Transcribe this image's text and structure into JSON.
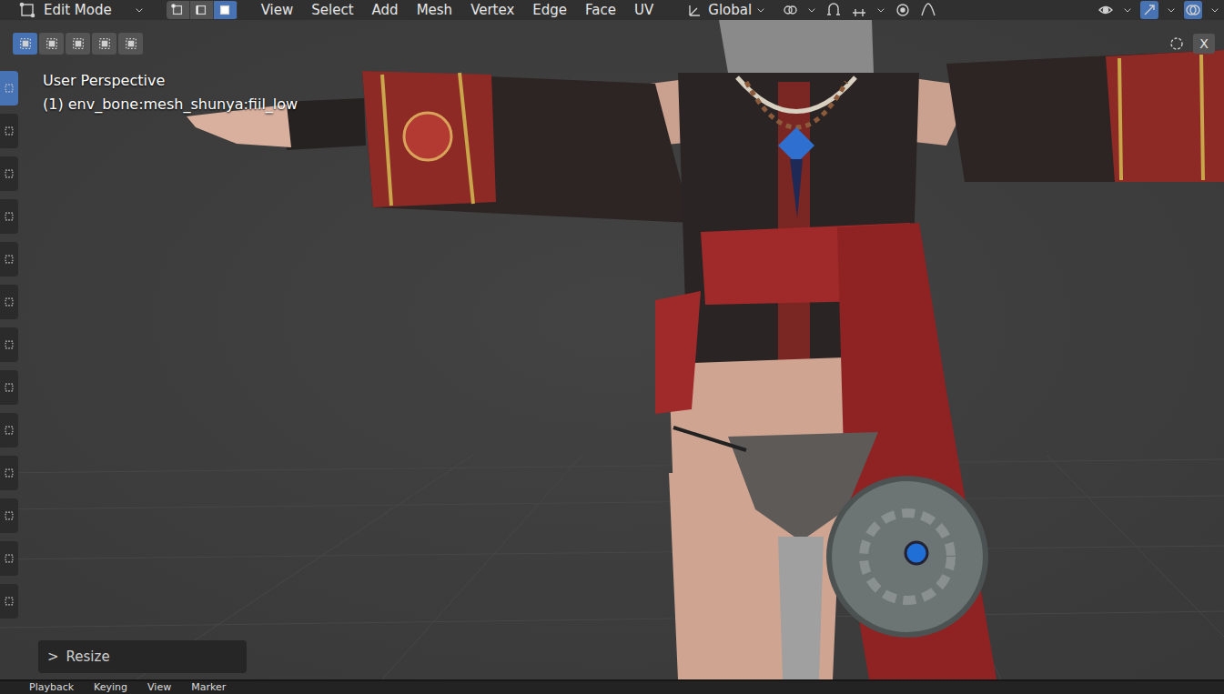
{
  "header": {
    "mode": "Edit Mode",
    "select_modes": [
      {
        "selected": false
      },
      {
        "selected": false
      },
      {
        "selected": true
      }
    ],
    "menus": [
      "View",
      "Select",
      "Add",
      "Mesh",
      "Vertex",
      "Edge",
      "Face",
      "UV"
    ],
    "orientation": "Global"
  },
  "box_modes": [
    {
      "selected": true
    },
    {
      "selected": false
    },
    {
      "selected": false
    },
    {
      "selected": false
    },
    {
      "selected": false
    }
  ],
  "toolbar": {
    "tools": [
      {
        "selected": true
      },
      {
        "selected": false
      },
      {
        "selected": false
      },
      {
        "selected": false
      },
      {
        "selected": false
      },
      {
        "selected": false
      },
      {
        "selected": false
      },
      {
        "selected": false
      },
      {
        "selected": false
      },
      {
        "selected": false
      },
      {
        "selected": false
      },
      {
        "selected": false
      },
      {
        "selected": false
      }
    ]
  },
  "viewport": {
    "view_name": "User Perspective",
    "object_info": "(1) env_bone:mesh_shunya:fiil_low",
    "close": "X"
  },
  "operator_panel": {
    "chevron": ">",
    "title": "Resize",
    "expanded": false
  },
  "timeline": {
    "items": [
      "Playback",
      "Keying",
      "View",
      "Marker"
    ]
  }
}
